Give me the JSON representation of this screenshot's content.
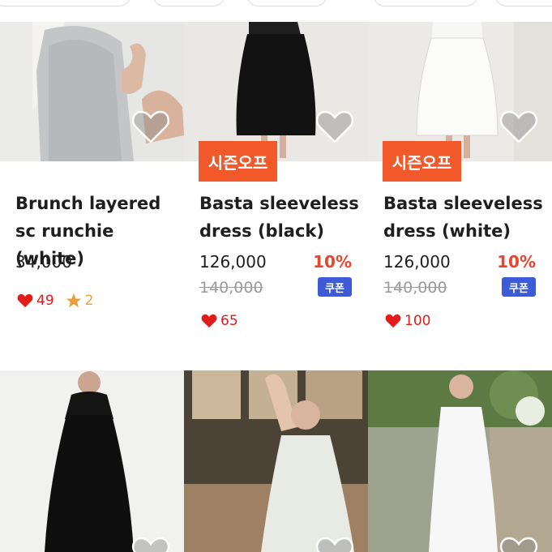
{
  "products": [
    {
      "title": "Brunch layered sc runchie (white)",
      "price": "34,000",
      "likes": "49",
      "rating": "2"
    },
    {
      "badge": "시즌오프",
      "title": "Basta sleeveless dress (black)",
      "price": "126,000",
      "original_price": "140,000",
      "discount": "10%",
      "coupon": "쿠폰",
      "likes": "65"
    },
    {
      "badge": "시즌오프",
      "title": "Basta sleeveless dress (white)",
      "price": "126,000",
      "original_price": "140,000",
      "discount": "10%",
      "coupon": "쿠폰",
      "likes": "100"
    }
  ],
  "icons": {
    "wishlist": "heart-outline-icon",
    "like": "heart-icon",
    "rating": "star-icon"
  },
  "colors": {
    "badge": "#f2592a",
    "discount": "#e8452f",
    "coupon": "#3d5bd6",
    "like": "#e21b1b",
    "star": "#e89f3a"
  }
}
